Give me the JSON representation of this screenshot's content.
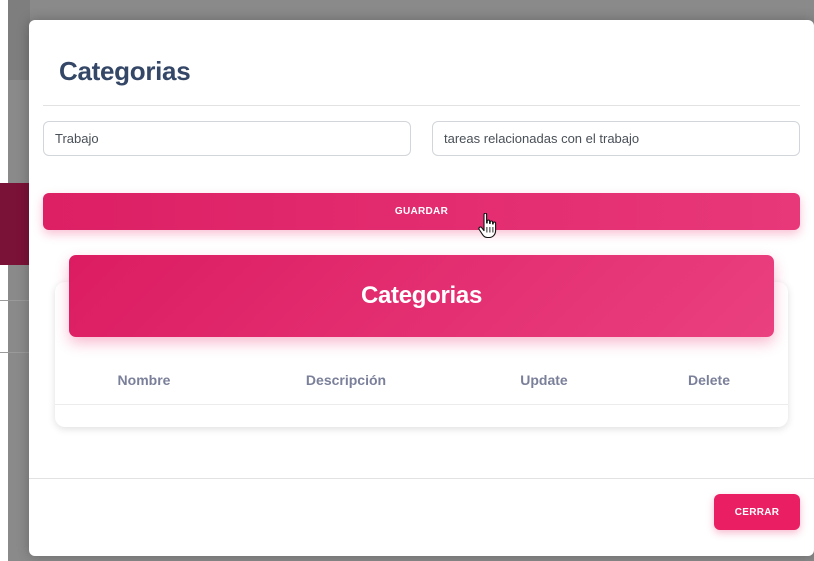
{
  "modal": {
    "title": "Categorias",
    "form": {
      "name_value": "Trabajo",
      "description_value": "tareas relacionadas con el trabajo",
      "save_label": "GUARDAR"
    },
    "card": {
      "title": "Categorias",
      "columns": [
        "Nombre",
        "Descripción",
        "Update",
        "Delete"
      ]
    },
    "close_label": "CERRAR"
  },
  "colors": {
    "accent": "#e91e63",
    "title": "#344767",
    "muted": "#7b809a"
  },
  "icons": {
    "cursor": "hand-pointer-icon"
  }
}
